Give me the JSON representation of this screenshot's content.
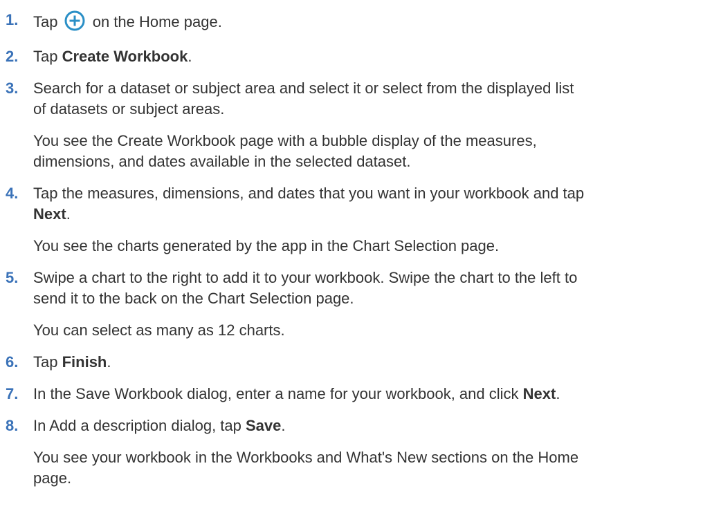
{
  "steps": [
    {
      "number": "1.",
      "segments": [
        {
          "text": "Tap "
        },
        {
          "icon": "add-circle-icon",
          "color": "#2a8fc6"
        },
        {
          "text": " on the Home page."
        }
      ]
    },
    {
      "number": "2.",
      "segments": [
        {
          "text": "Tap "
        },
        {
          "bold": "Create Workbook"
        },
        {
          "text": "."
        }
      ]
    },
    {
      "number": "3.",
      "lines": [
        "Search for a dataset or subject area and select it or select from the displayed list",
        "of datasets or subject areas."
      ],
      "note_lines": [
        "You see the Create Workbook page with a bubble display of the measures,",
        "dimensions, and dates available in the selected dataset."
      ]
    },
    {
      "number": "4.",
      "line1": "Tap the measures, dimensions, and dates that you want in your workbook and tap",
      "bold": "Next",
      "tail": ".",
      "note": "You see the charts generated by the app in the Chart Selection page."
    },
    {
      "number": "5.",
      "lines": [
        "Swipe a chart to the right to add it to your workbook. Swipe the chart to the left to",
        "send it to the back on the Chart Selection page."
      ],
      "note": "You can select as many as 12 charts."
    },
    {
      "number": "6.",
      "prefix": "Tap ",
      "bold": "Finish",
      "tail": "."
    },
    {
      "number": "7.",
      "prefix": "In the Save Workbook dialog, enter a name for your workbook, and click ",
      "bold": "Next",
      "tail": "."
    },
    {
      "number": "8.",
      "prefix": "In Add a description dialog, tap ",
      "bold": "Save",
      "tail": ".",
      "note_lines": [
        "You see your workbook in the Workbooks and What's New sections on the Home",
        "page."
      ]
    }
  ]
}
